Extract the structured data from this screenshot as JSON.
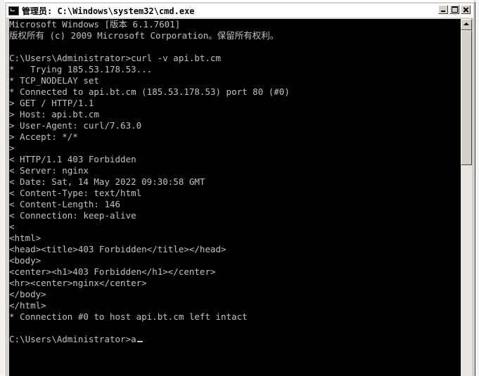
{
  "window": {
    "title": "管理员: C:\\Windows\\system32\\cmd.exe",
    "buttons": {
      "minimize": "minimize",
      "maximize": "maximize",
      "close": "close"
    }
  },
  "console": {
    "lines": [
      "Microsoft Windows [版本 6.1.7601]",
      "版权所有 (c) 2009 Microsoft Corporation。保留所有权利。",
      "",
      "C:\\Users\\Administrator>curl -v api.bt.cm",
      "*   Trying 185.53.178.53...",
      "* TCP_NODELAY set",
      "* Connected to api.bt.cm (185.53.178.53) port 80 (#0)",
      "> GET / HTTP/1.1",
      "> Host: api.bt.cm",
      "> User-Agent: curl/7.63.0",
      "> Accept: */*",
      ">",
      "< HTTP/1.1 403 Forbidden",
      "< Server: nginx",
      "< Date: Sat, 14 May 2022 09:30:58 GMT",
      "< Content-Type: text/html",
      "< Content-Length: 146",
      "< Connection: keep-alive",
      "<",
      "<html>",
      "<head><title>403 Forbidden</title></head>",
      "<body>",
      "<center><h1>403 Forbidden</h1></center>",
      "<hr><center>nginx</center>",
      "</body>",
      "</html>",
      "* Connection #0 to host api.bt.cm left intact",
      ""
    ],
    "prompt": "C:\\Users\\Administrator>a"
  },
  "colors": {
    "console_bg": "#000000",
    "console_fg": "#c0c0c0",
    "chrome": "#d4d0c8"
  },
  "scrollbar": {
    "thumb_fraction": 0.39
  }
}
